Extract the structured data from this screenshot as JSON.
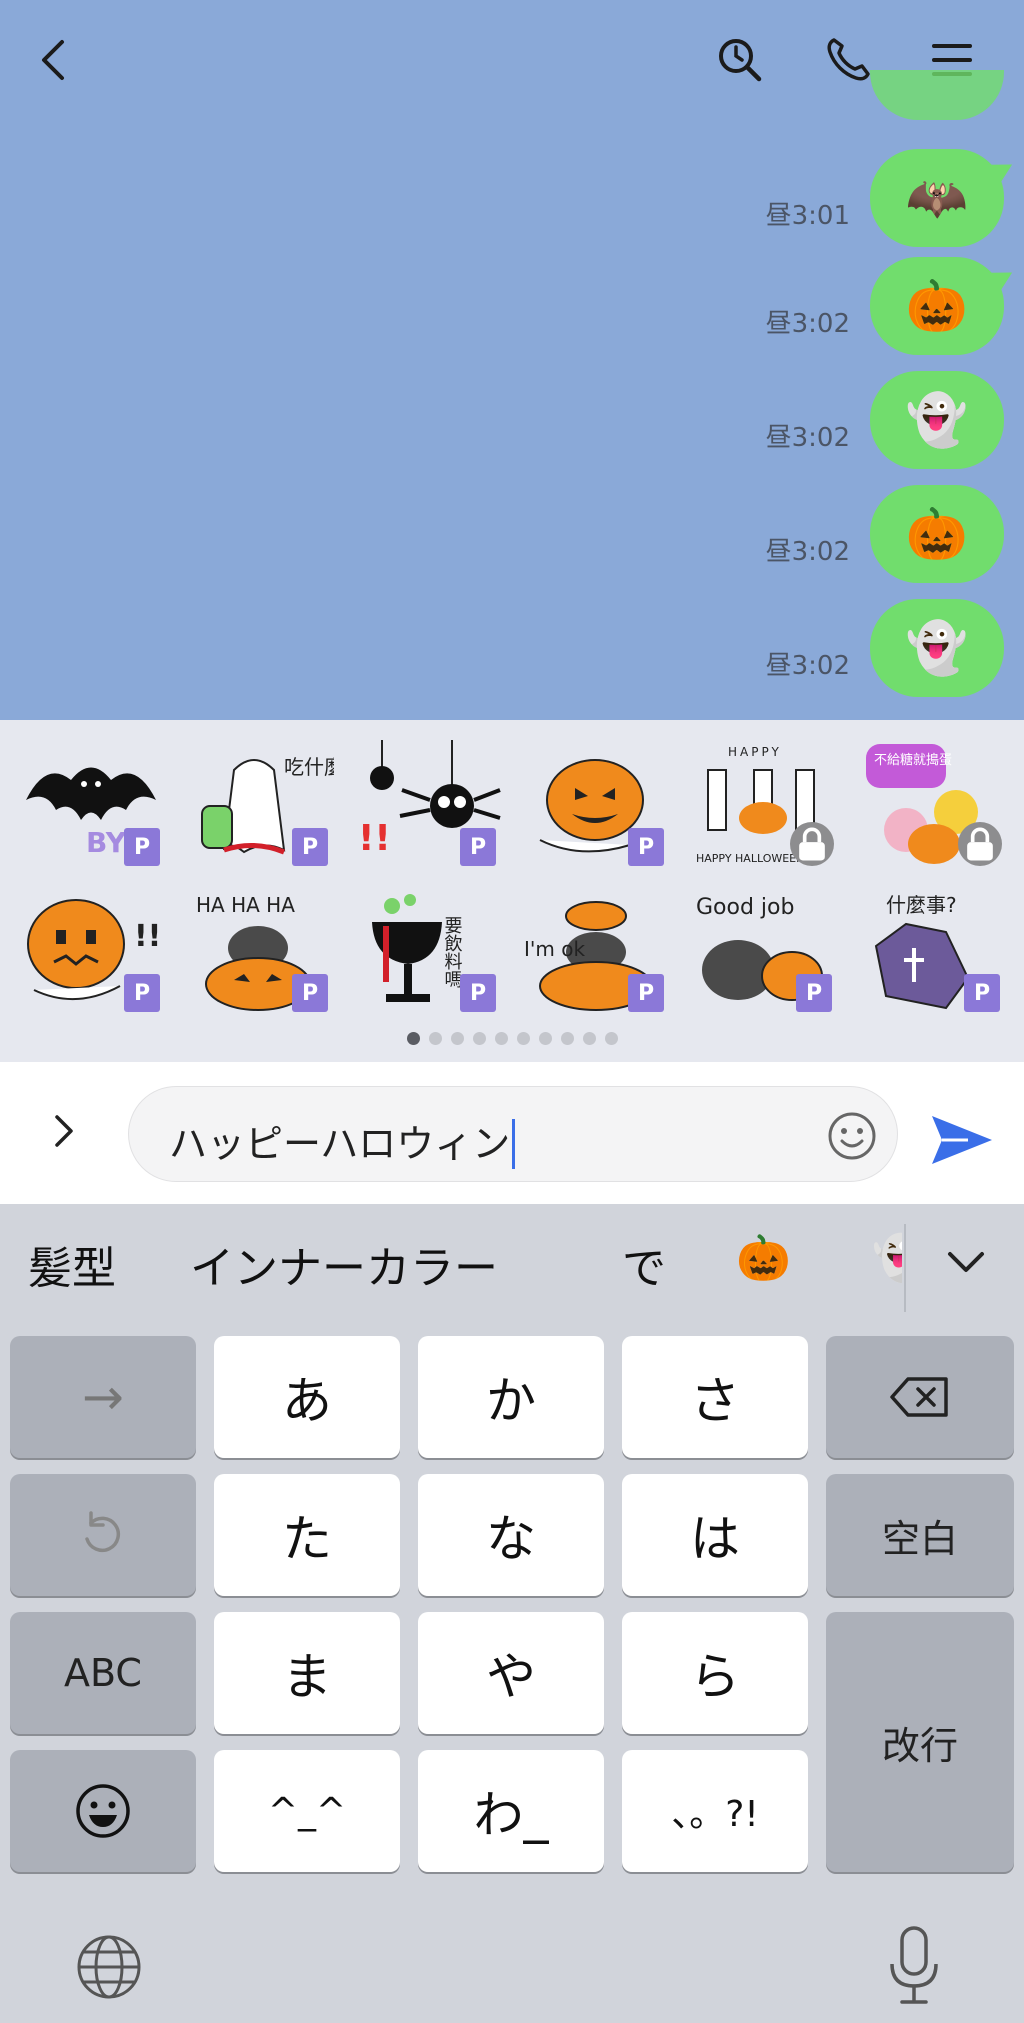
{
  "chat": {
    "messages": [
      {
        "time": "昼3:01",
        "emoji": "🦇"
      },
      {
        "time": "昼3:02",
        "emoji": "🎃"
      },
      {
        "time": "昼3:02",
        "emoji": "👻"
      },
      {
        "time": "昼3:02",
        "emoji": "🎃"
      },
      {
        "time": "昼3:02",
        "emoji": "👻"
      }
    ]
  },
  "stickers": {
    "items": [
      {
        "label": "BYE",
        "badge": "P"
      },
      {
        "label": "吃什麼?",
        "badge": "P"
      },
      {
        "label": "",
        "badge": "P"
      },
      {
        "label": "",
        "badge": "P"
      },
      {
        "label": "HAPPY HALLOWEEN",
        "badge": "lock"
      },
      {
        "label": "不給糖就搗蛋",
        "badge": "lock"
      },
      {
        "label": "",
        "badge": "P"
      },
      {
        "label": "HA HA HA",
        "badge": "P"
      },
      {
        "label": "要飲料嗎",
        "badge": "P"
      },
      {
        "label": "I'm ok",
        "badge": "P"
      },
      {
        "label": "Good job",
        "badge": "P"
      },
      {
        "label": "什麼事?",
        "badge": "P"
      }
    ],
    "page_count": 10,
    "active_page": 1
  },
  "input": {
    "value": "ハッピーハロウィン"
  },
  "keyboard": {
    "suggestions": [
      "髪型",
      "インナーカラー",
      "で",
      "🎃",
      "👻"
    ],
    "keys": {
      "arrow": "→",
      "a": "あ",
      "ka": "か",
      "sa": "さ",
      "ta": "た",
      "na": "な",
      "ha": "は",
      "abc": "ABC",
      "ma": "ま",
      "ya": "や",
      "ra": "ら",
      "kaomoji": "^_^",
      "wa": "わ_",
      "punct": "、。?!",
      "space": "空白",
      "enter": "改行"
    }
  },
  "colors": {
    "chat_bg": "#8aa9d8",
    "bubble": "#71dd6d",
    "sticker_badge": "#8b78d8",
    "send": "#3a6ee8"
  }
}
